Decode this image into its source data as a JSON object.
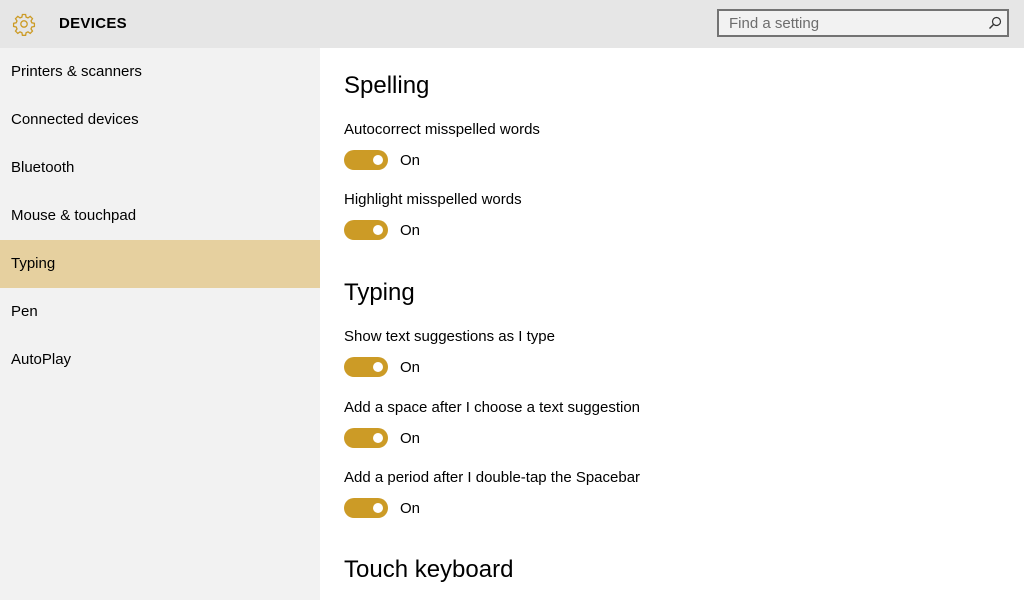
{
  "header": {
    "title": "DEVICES",
    "icon": "gear-icon",
    "search": {
      "placeholder": "Find a setting",
      "value": ""
    }
  },
  "colors": {
    "accent": "#cc9b26",
    "selected_bg": "#e6d09f",
    "sidebar_bg": "#f2f2f2",
    "header_bg": "#e6e6e6"
  },
  "sidebar": {
    "items": [
      {
        "label": "Printers & scanners"
      },
      {
        "label": "Connected devices"
      },
      {
        "label": "Bluetooth"
      },
      {
        "label": "Mouse & touchpad"
      },
      {
        "label": "Typing",
        "selected": true
      },
      {
        "label": "Pen"
      },
      {
        "label": "AutoPlay"
      }
    ]
  },
  "content": {
    "spelling": {
      "title": "Spelling",
      "autocorrect": {
        "label": "Autocorrect misspelled words",
        "state": "On"
      },
      "highlight": {
        "label": "Highlight misspelled words",
        "state": "On"
      }
    },
    "typing": {
      "title": "Typing",
      "suggestions": {
        "label": "Show text suggestions as I type",
        "state": "On"
      },
      "add_space": {
        "label": "Add a space after I choose a text suggestion",
        "state": "On"
      },
      "add_period": {
        "label": "Add a period after I double-tap the Spacebar",
        "state": "On"
      }
    },
    "touch_keyboard": {
      "title": "Touch keyboard"
    }
  }
}
